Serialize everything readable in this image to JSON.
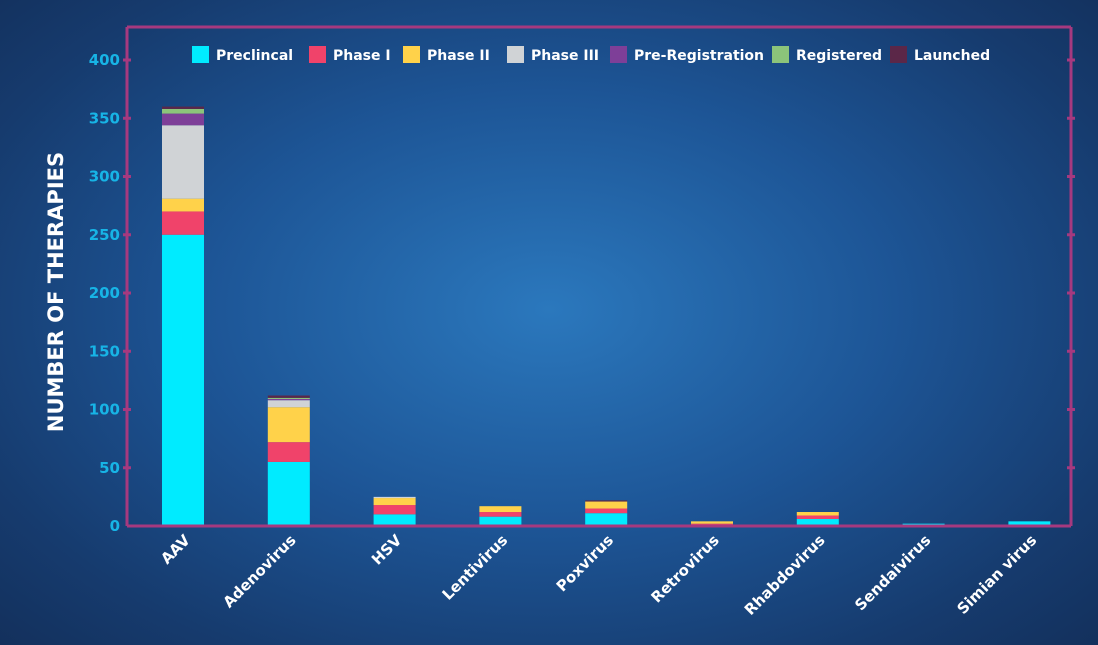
{
  "chart_data": {
    "type": "bar",
    "stacked": true,
    "ylabel": "NUMBER OF THERAPIES",
    "ylim": [
      0,
      425
    ],
    "yticks": [
      0,
      50,
      100,
      150,
      200,
      250,
      300,
      350,
      400
    ],
    "legend_position": "top",
    "frame_color": "#a6397f",
    "categories": [
      "AAV",
      "Adenovirus",
      "HSV",
      "Lentivirus",
      "Poxvirus",
      "Retrovirus",
      "Rhabdovirus",
      "Sendaivirus",
      "Simian virus"
    ],
    "series": [
      {
        "name": "Preclincal",
        "color": "#00ebff",
        "values": [
          250,
          55,
          10,
          8,
          11,
          1,
          6,
          2,
          4
        ]
      },
      {
        "name": "Phase I",
        "color": "#f0436a",
        "values": [
          20,
          17,
          8,
          4,
          4,
          1,
          3,
          0,
          0
        ]
      },
      {
        "name": "Phase II",
        "color": "#ffd24a",
        "values": [
          11,
          30,
          6,
          5,
          6,
          2,
          3,
          0,
          0
        ]
      },
      {
        "name": "Phase III",
        "color": "#d0d3d6",
        "values": [
          63,
          6,
          1,
          0,
          0,
          0,
          0,
          0,
          0
        ]
      },
      {
        "name": "Pre-Registration",
        "color": "#7e3f98",
        "values": [
          10,
          1,
          0,
          0,
          0,
          0,
          0,
          0,
          0
        ]
      },
      {
        "name": "Registered",
        "color": "#8cc47a",
        "values": [
          4,
          1,
          0,
          0,
          0,
          0,
          0,
          0,
          0
        ]
      },
      {
        "name": "Launched",
        "color": "#5b2748",
        "values": [
          2,
          2,
          0,
          0,
          1,
          0,
          0,
          0,
          0
        ]
      }
    ]
  }
}
